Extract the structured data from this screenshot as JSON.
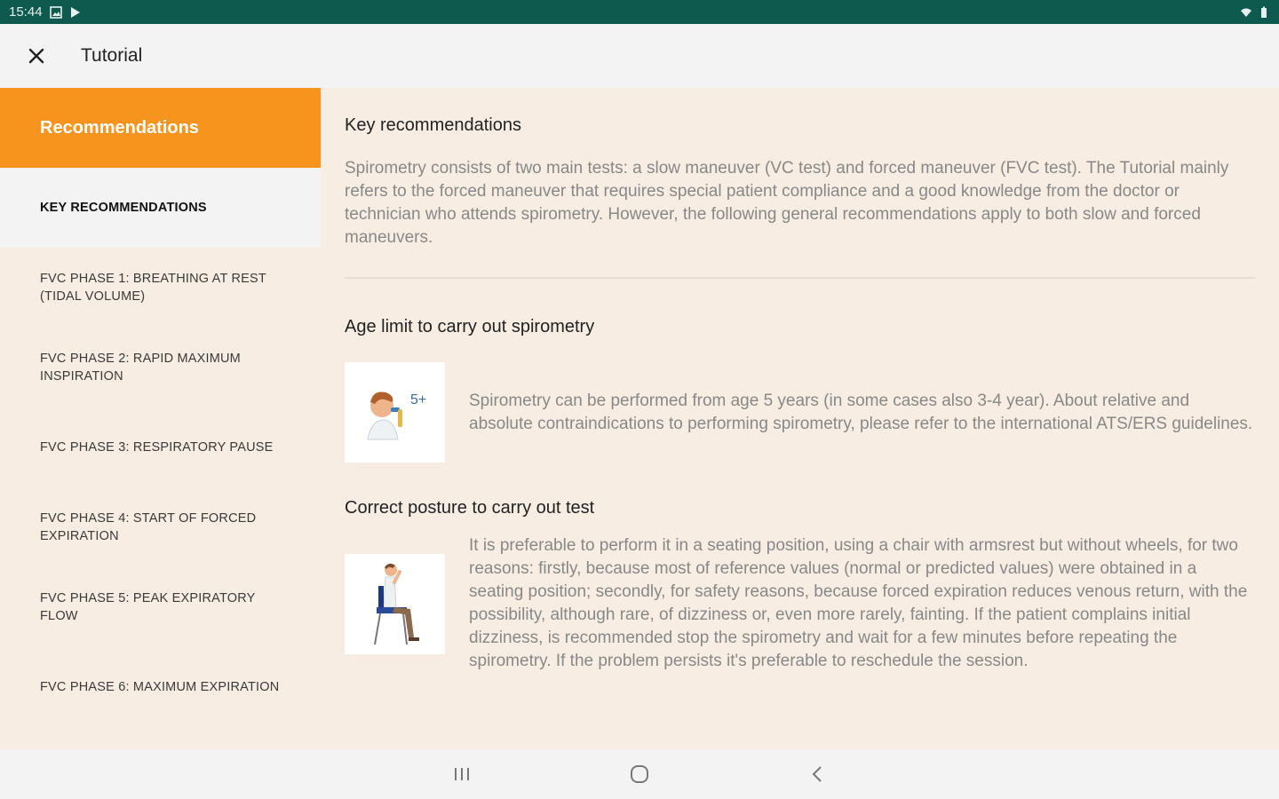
{
  "status_bar": {
    "time": "15:44"
  },
  "app_bar": {
    "title": "Tutorial"
  },
  "sidebar": {
    "header": "Recommendations",
    "items": [
      {
        "label": "KEY RECOMMENDATIONS",
        "active": true
      },
      {
        "label": "FVC PHASE 1: BREATHING AT REST (TIDAL VOLUME)"
      },
      {
        "label": "FVC PHASE 2: RAPID MAXIMUM INSPIRATION"
      },
      {
        "label": "FVC PHASE 3: RESPIRATORY PAUSE"
      },
      {
        "label": "FVC PHASE 4: START OF FORCED EXPIRATION"
      },
      {
        "label": "FVC PHASE 5: PEAK EXPIRATORY FLOW"
      },
      {
        "label": "FVC PHASE 6: MAXIMUM EXPIRATION"
      }
    ]
  },
  "content": {
    "title": "Key recommendations",
    "intro": "Spirometry consists of two main tests: a slow maneuver (VC test) and forced maneuver (FVC test). The Tutorial mainly refers to the forced maneuver that requires special patient compliance and a good knowledge from the doctor or technician who attends spirometry. However, the following general recommendations apply to both slow and forced maneuvers.",
    "sections": [
      {
        "title": "Age limit to carry out spirometry",
        "badge": "5+",
        "text": "Spirometry can be performed from age 5 years (in some cases also 3-4 year). About relative and absolute contraindications to performing spirometry, please refer to the international ATS/ERS guidelines."
      },
      {
        "title": "Correct posture to carry out test",
        "text": "It is preferable to perform it in a seating position, using a chair with armsrest but without wheels, for two reasons: firstly, because most of reference values (normal or predicted values) were obtained in a seating position; secondly, for safety reasons, because forced expiration reduces venous return, with the possibility, although rare, of dizziness or, even more rarely, fainting. If the patient complains initial dizziness, is recommended stop the spirometry and wait for a few minutes before repeating the spirometry. If the problem persists it's preferable to reschedule the session."
      }
    ]
  },
  "colors": {
    "accent": "#f7941d",
    "status_bar": "#0e5a4f",
    "background": "#f7ede3"
  }
}
